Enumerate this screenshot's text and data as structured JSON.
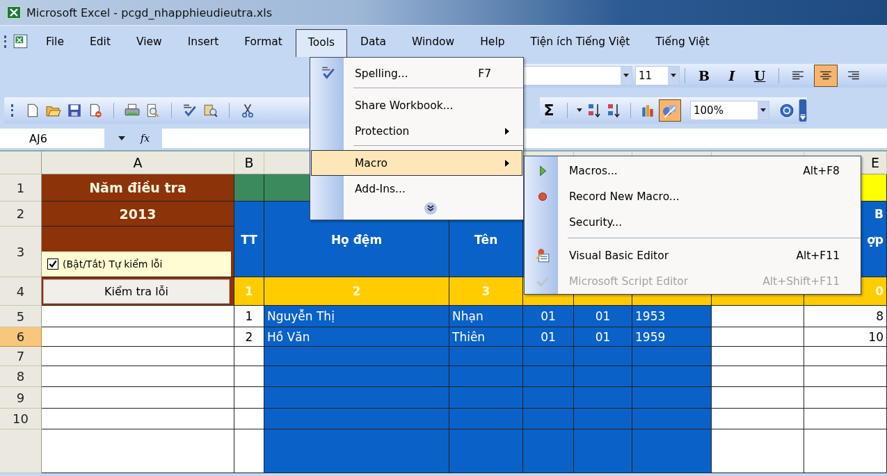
{
  "window": {
    "title": "Microsoft Excel - pcgd_nhapphieudieutra.xls"
  },
  "menu_bar": [
    {
      "label": "File",
      "selected": false
    },
    {
      "label": "Edit",
      "selected": false
    },
    {
      "label": "View",
      "selected": false
    },
    {
      "label": "Insert",
      "selected": false
    },
    {
      "label": "Format",
      "selected": false
    },
    {
      "label": "Tools",
      "selected": true
    },
    {
      "label": "Data",
      "selected": false
    },
    {
      "label": "Window",
      "selected": false
    },
    {
      "label": "Help",
      "selected": false
    },
    {
      "label": "Tiện ích Tiếng Việt",
      "selected": false
    },
    {
      "label": "Tiếng Việt",
      "selected": false
    }
  ],
  "formatting_toolbar": {
    "font_size": "11",
    "buttons": [
      {
        "kind": "bold",
        "label": "B",
        "active": false
      },
      {
        "kind": "italic",
        "label": "I",
        "active": false
      },
      {
        "kind": "underline",
        "label": "U",
        "active": false
      },
      {
        "kind": "align-left",
        "active": false
      },
      {
        "kind": "align-center",
        "active": true
      },
      {
        "kind": "align-right",
        "active": false
      }
    ]
  },
  "standard_toolbar": {
    "left_buttons": [
      {
        "kind": "new"
      },
      {
        "kind": "open"
      },
      {
        "kind": "save"
      },
      {
        "kind": "permission"
      },
      {
        "kind": "print"
      },
      {
        "kind": "preview"
      },
      {
        "kind": "spelling"
      },
      {
        "kind": "research"
      },
      {
        "kind": "cut"
      }
    ],
    "right_buttons": [
      {
        "kind": "autosum",
        "label": "Σ",
        "active": false
      },
      {
        "kind": "caret",
        "active": false
      },
      {
        "kind": "sort-ascending",
        "active": false
      },
      {
        "kind": "sort-descending",
        "active": false
      },
      {
        "kind": "chart",
        "active": false
      },
      {
        "kind": "drawing",
        "active": true
      }
    ],
    "zoom": "100%"
  },
  "formula_bar": {
    "name_box": "AJ6",
    "fx": "fx"
  },
  "column_headers": {
    "column_1": "A",
    "column_2": "B",
    "column_9": "E"
  },
  "rows": [
    {
      "number": "1",
      "selected": false,
      "cells": [
        {
          "kind": "title",
          "text": "Năm điều tra"
        },
        {
          "kind": "band"
        },
        {
          "kind": "band"
        },
        {
          "kind": "band"
        },
        {
          "kind": "band"
        },
        {
          "kind": "band"
        },
        {
          "kind": "band"
        },
        {
          "kind": "band"
        },
        {
          "kind": "accent"
        }
      ]
    },
    {
      "number": "2",
      "selected": false,
      "cells": [
        {
          "kind": "title",
          "text": "2013"
        },
        {
          "kind": "head"
        },
        {
          "kind": "head"
        },
        {
          "kind": "head"
        },
        {
          "kind": "head"
        },
        {
          "kind": "head"
        },
        {
          "kind": "head"
        },
        {
          "kind": "head"
        },
        {
          "kind": "head",
          "text": "B"
        }
      ]
    },
    {
      "number": "3",
      "selected": false,
      "cells": [
        {
          "kind": "toggle",
          "text": "(Bật/Tắt) Tự kiểm lỗi",
          "checked": true
        },
        {
          "kind": "head",
          "text": "TT"
        },
        {
          "kind": "head",
          "text": "Họ đệm"
        },
        {
          "kind": "head",
          "text": "Tên"
        },
        {
          "kind": "head"
        },
        {
          "kind": "head"
        },
        {
          "kind": "head"
        },
        {
          "kind": "head"
        },
        {
          "kind": "head",
          "text": "ợp"
        }
      ]
    },
    {
      "number": "4",
      "selected": false,
      "cells": [
        {
          "kind": "action",
          "text": "Kiểm tra lỗi"
        },
        {
          "kind": "index",
          "text": "1"
        },
        {
          "kind": "index",
          "text": "2"
        },
        {
          "kind": "index",
          "text": "3"
        },
        {
          "kind": "index"
        },
        {
          "kind": "index"
        },
        {
          "kind": "index"
        },
        {
          "kind": "index"
        },
        {
          "kind": "index",
          "text": "0"
        }
      ]
    },
    {
      "number": "5",
      "selected": false,
      "cells": [
        {
          "kind": "plain"
        },
        {
          "kind": "plain",
          "text": "1"
        },
        {
          "kind": "data",
          "text": "Nguyễn Thị"
        },
        {
          "kind": "data",
          "text": "Nhạn"
        },
        {
          "kind": "data",
          "text": "01"
        },
        {
          "kind": "data",
          "text": "01"
        },
        {
          "kind": "data",
          "text": "1953"
        },
        {
          "kind": "plain"
        },
        {
          "kind": "plain",
          "text": "8"
        }
      ]
    },
    {
      "number": "6",
      "selected": true,
      "cells": [
        {
          "kind": "plain"
        },
        {
          "kind": "plain",
          "text": "2"
        },
        {
          "kind": "data",
          "text": "Hồ Văn"
        },
        {
          "kind": "data",
          "text": "Thiên"
        },
        {
          "kind": "data",
          "text": "01"
        },
        {
          "kind": "data",
          "text": "01"
        },
        {
          "kind": "data",
          "text": "1959"
        },
        {
          "kind": "plain"
        },
        {
          "kind": "plain",
          "text": "10"
        }
      ]
    },
    {
      "number": "7",
      "selected": false,
      "cells": [
        {
          "kind": "plain"
        },
        {
          "kind": "plain"
        },
        {
          "kind": "data"
        },
        {
          "kind": "data"
        },
        {
          "kind": "data"
        },
        {
          "kind": "data"
        },
        {
          "kind": "data"
        },
        {
          "kind": "plain"
        },
        {
          "kind": "plain"
        }
      ]
    },
    {
      "number": "8",
      "selected": false,
      "cells": [
        {
          "kind": "plain"
        },
        {
          "kind": "plain"
        },
        {
          "kind": "data"
        },
        {
          "kind": "data"
        },
        {
          "kind": "data"
        },
        {
          "kind": "data"
        },
        {
          "kind": "data"
        },
        {
          "kind": "plain"
        },
        {
          "kind": "plain"
        }
      ]
    },
    {
      "number": "9",
      "selected": false,
      "cells": [
        {
          "kind": "plain"
        },
        {
          "kind": "plain"
        },
        {
          "kind": "data"
        },
        {
          "kind": "data"
        },
        {
          "kind": "data"
        },
        {
          "kind": "data"
        },
        {
          "kind": "data"
        },
        {
          "kind": "plain"
        },
        {
          "kind": "plain"
        }
      ]
    },
    {
      "number": "10",
      "selected": false,
      "cells": [
        {
          "kind": "plain"
        },
        {
          "kind": "plain"
        },
        {
          "kind": "data"
        },
        {
          "kind": "data"
        },
        {
          "kind": "data"
        },
        {
          "kind": "data"
        },
        {
          "kind": "data"
        },
        {
          "kind": "plain"
        },
        {
          "kind": "plain"
        }
      ]
    },
    {
      "selected": false,
      "cells": [
        {
          "kind": "plain"
        },
        {
          "kind": "plain"
        },
        {
          "kind": "data"
        },
        {
          "kind": "data"
        },
        {
          "kind": "data"
        },
        {
          "kind": "data"
        },
        {
          "kind": "data"
        },
        {
          "kind": "plain"
        },
        {
          "kind": "plain"
        }
      ]
    }
  ],
  "tools_menu": {
    "items": [
      {
        "kind": "spelling",
        "label": "Spelling...",
        "shortcut": "F7",
        "has_submenu": false,
        "selected": false
      },
      {
        "kind": "separator"
      },
      {
        "kind": "plain",
        "label": "Share Workbook...",
        "has_submenu": false,
        "selected": false
      },
      {
        "kind": "plain",
        "label": "Protection",
        "has_submenu": true,
        "selected": false
      },
      {
        "kind": "separator"
      },
      {
        "kind": "plain",
        "label": "Macro",
        "has_submenu": true,
        "selected": true
      },
      {
        "kind": "plain",
        "label": "Add-Ins...",
        "has_submenu": false,
        "selected": false
      },
      {
        "kind": "more"
      }
    ]
  },
  "macro_submenu": {
    "items": [
      {
        "kind": "run",
        "label": "Macros...",
        "shortcut": "Alt+F8",
        "disabled": false
      },
      {
        "kind": "record",
        "label": "Record New Macro...",
        "disabled": false
      },
      {
        "kind": "plain",
        "label": "Security...",
        "disabled": false
      },
      {
        "kind": "separator"
      },
      {
        "kind": "vbe",
        "label": "Visual Basic Editor",
        "shortcut": "Alt+F11",
        "disabled": false
      },
      {
        "kind": "script",
        "label": "Microsoft Script Editor",
        "shortcut": "Alt+Shift+F11",
        "disabled": true
      }
    ]
  }
}
